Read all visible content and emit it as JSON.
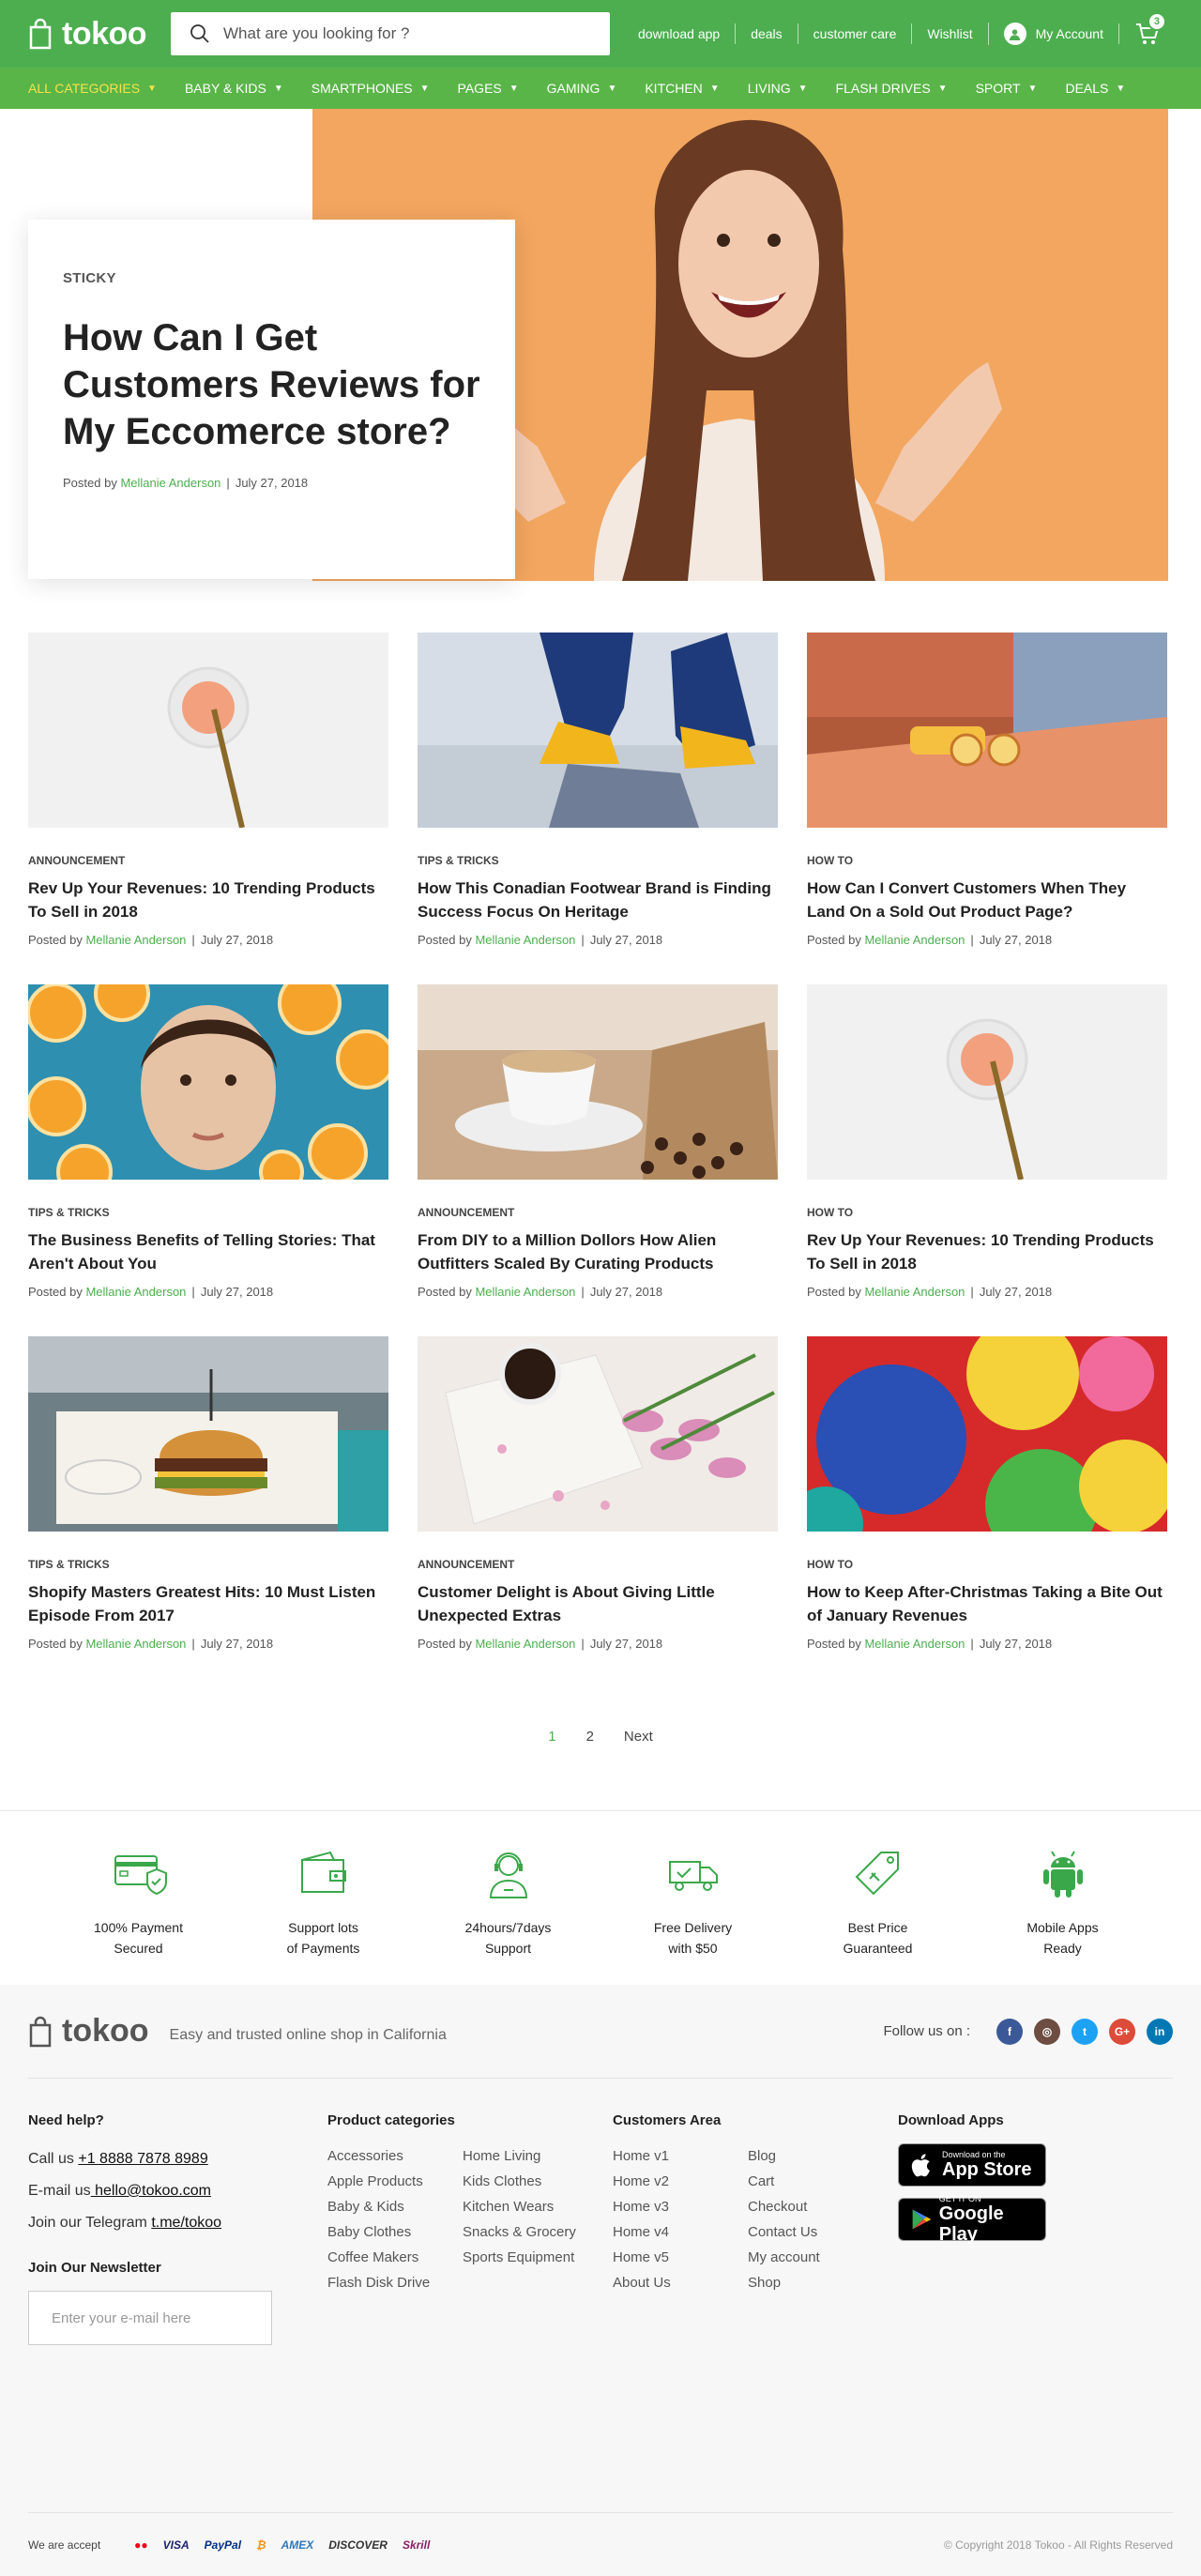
{
  "header": {
    "logo_text": "tokoo",
    "search_placeholder": "What are you looking for ?",
    "top_links": [
      "download app",
      "deals",
      "customer care",
      "Wishlist"
    ],
    "account_label": "My Account",
    "cart_count": "3"
  },
  "nav": {
    "items": [
      {
        "label": "ALL CATEGORIES",
        "active": true
      },
      {
        "label": "BABY & KIDS"
      },
      {
        "label": "SMARTPHONES"
      },
      {
        "label": "PAGES"
      },
      {
        "label": "GAMING"
      },
      {
        "label": "KITCHEN"
      },
      {
        "label": "LIVING"
      },
      {
        "label": "FLASH DRIVES"
      },
      {
        "label": "SPORT"
      },
      {
        "label": "DEALS"
      }
    ]
  },
  "hero": {
    "tag": "STICKY",
    "title": "How Can I Get Customers Reviews for My Eccomerce store?",
    "posted_by": "Posted by",
    "author": "Mellanie Anderson",
    "date": "July 27, 2018"
  },
  "posts": [
    {
      "category": "ANNOUNCEMENT",
      "title": "Rev Up Your Revenues: 10 Trending Products To Sell in 2018",
      "author": "Mellanie Anderson",
      "date": "July 27, 2018"
    },
    {
      "category": "TIPS & TRICKS",
      "title": "How This Conadian Footwear Brand is Finding Success Focus On Heritage",
      "author": "Mellanie Anderson",
      "date": "July 27, 2018"
    },
    {
      "category": "HOW TO",
      "title": "How Can I Convert Customers When They Land On a Sold Out Product Page?",
      "author": "Mellanie Anderson",
      "date": "July 27, 2018"
    },
    {
      "category": "TIPS & TRICKS",
      "title": "The Business Benefits of Telling Stories: That Aren't About You",
      "author": "Mellanie Anderson",
      "date": "July 27, 2018"
    },
    {
      "category": "ANNOUNCEMENT",
      "title": "From DIY to a Million Dollors How Alien Outfitters Scaled By Curating Products",
      "author": "Mellanie Anderson",
      "date": "July 27, 2018"
    },
    {
      "category": "HOW TO",
      "title": "Rev Up Your Revenues: 10 Trending Products To Sell in 2018",
      "author": "Mellanie Anderson",
      "date": "July 27, 2018"
    },
    {
      "category": "TIPS & TRICKS",
      "title": "Shopify Masters Greatest Hits: 10 Must Listen Episode From 2017",
      "author": "Mellanie Anderson",
      "date": "July 27, 2018"
    },
    {
      "category": "ANNOUNCEMENT",
      "title": "Customer Delight is About Giving Little Unexpected Extras",
      "author": "Mellanie Anderson",
      "date": "July 27, 2018"
    },
    {
      "category": "HOW TO",
      "title": "How to Keep After-Christmas Taking a Bite Out of January Revenues",
      "author": "Mellanie Anderson",
      "date": "July 27, 2018"
    }
  ],
  "posted_by_label": "Posted by",
  "pagination": {
    "pages": [
      "1",
      "2"
    ],
    "next": "Next",
    "current": "1"
  },
  "features": [
    {
      "icon": "credit-card-shield-icon",
      "text": "100% Payment\nSecured"
    },
    {
      "icon": "wallet-icon",
      "text": "Support lots\nof Payments"
    },
    {
      "icon": "support-agent-icon",
      "text": "24hours/7days\nSupport"
    },
    {
      "icon": "delivery-truck-icon",
      "text": "Free Delivery\nwith $50"
    },
    {
      "icon": "price-tag-icon",
      "text": "Best Price\nGuaranteed"
    },
    {
      "icon": "android-icon",
      "text": "Mobile Apps\nReady"
    }
  ],
  "footer": {
    "logo_text": "tokoo",
    "tagline": "Easy and trusted online shop in California",
    "follow_label": "Follow us on :",
    "social": [
      {
        "name": "facebook-icon",
        "glyph": "f",
        "color": "#3b5998"
      },
      {
        "name": "instagram-icon",
        "glyph": "◎",
        "color": "#6d4c41"
      },
      {
        "name": "twitter-icon",
        "glyph": "t",
        "color": "#1da1f2"
      },
      {
        "name": "google-plus-icon",
        "glyph": "G+",
        "color": "#dd4b39"
      },
      {
        "name": "linkedin-icon",
        "glyph": "in",
        "color": "#0077b5"
      }
    ],
    "help": {
      "title": "Need help?",
      "call_prefix": "Call us ",
      "phone": "+1 8888 7878 8989",
      "email_prefix": "E-mail us",
      "email": " hello@tokoo.com",
      "telegram_prefix": "Join our Telegram ",
      "telegram": "t.me/tokoo",
      "newsletter_title": "Join Our Newsletter",
      "newsletter_placeholder": "Enter your e-mail here"
    },
    "product_categories": {
      "title": "Product categories",
      "col1": [
        "Accessories",
        "Apple Products",
        "Baby & Kids",
        "Baby Clothes",
        "Coffee Makers",
        "Flash Disk Drive"
      ],
      "col2": [
        "Home Living",
        "Kids Clothes",
        "Kitchen Wears",
        "Snacks & Grocery",
        "Sports Equipment"
      ]
    },
    "customers_area": {
      "title": "Customers Area",
      "col1": [
        "Home v1",
        "Home v2",
        "Home v3",
        "Home v4",
        "Home v5",
        "About Us"
      ],
      "col2": [
        "Blog",
        "Cart",
        "Checkout",
        "Contact Us",
        "My account",
        "Shop"
      ]
    },
    "apps": {
      "title": "Download Apps",
      "appstore_small": "Download on the",
      "appstore_big": "App Store",
      "googleplay_small": "GET IT ON",
      "googleplay_big": "Google Play"
    },
    "accept_label": "We are accept",
    "payments": [
      {
        "name": "mastercard-icon",
        "label": "●●",
        "color": "#eb001b"
      },
      {
        "name": "visa-icon",
        "label": "VISA",
        "color": "#1a1f71"
      },
      {
        "name": "paypal-icon",
        "label": "PayPal",
        "color": "#003087"
      },
      {
        "name": "bitcoin-icon",
        "label": "₿",
        "color": "#f7931a"
      },
      {
        "name": "amex-icon",
        "label": "AMEX",
        "color": "#2e77bc"
      },
      {
        "name": "discover-icon",
        "label": "DISCOVER",
        "color": "#333333"
      },
      {
        "name": "skrill-icon",
        "label": "Skrill",
        "color": "#862165"
      }
    ],
    "copyright": "© Copyright 2018 Tokoo - All Rights Reserved"
  },
  "colors": {
    "brand_green": "#4cae4f",
    "nav_green": "#5ab548",
    "active_yellow": "#f7e24a",
    "hero_orange": "#f2a65f"
  }
}
